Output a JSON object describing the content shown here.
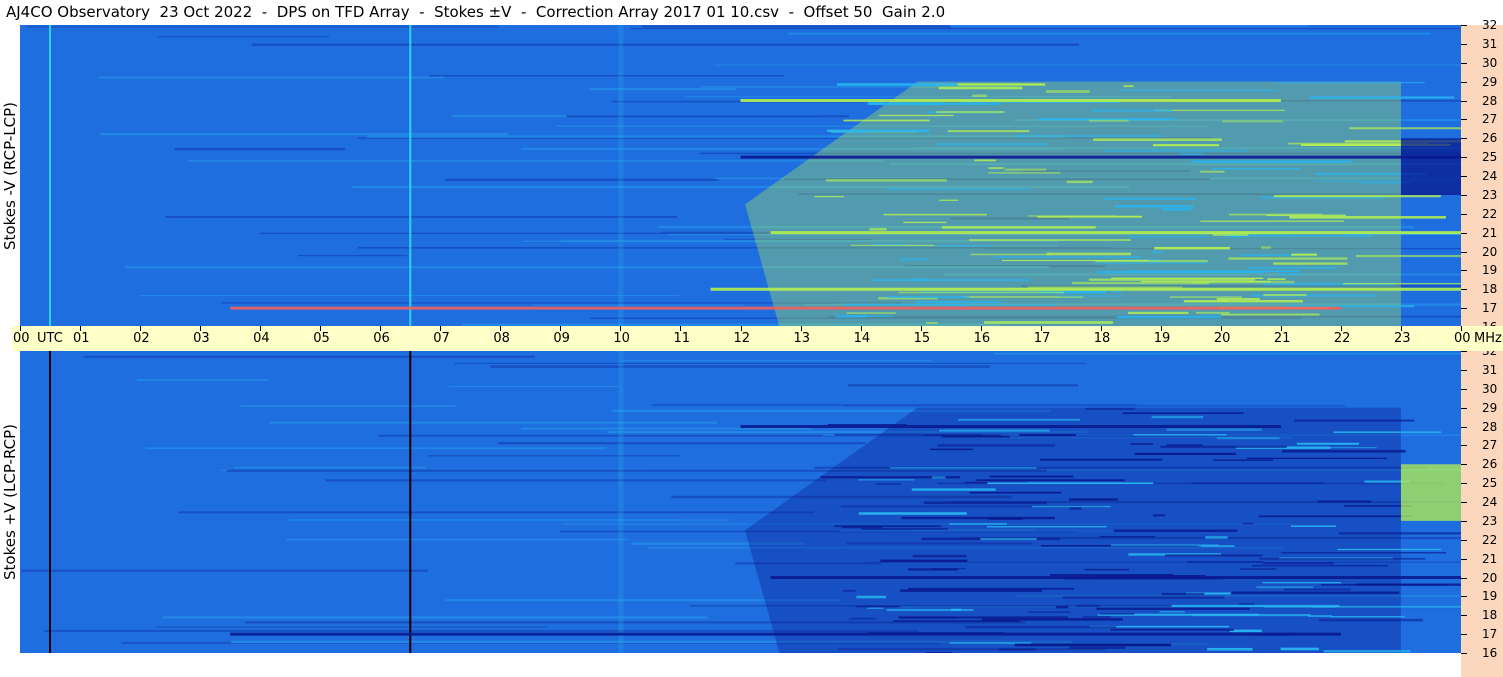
{
  "title": "AJ4CO Observatory  23 Oct 2022  -  DPS on TFD Array  -  Stokes ±V  -  Correction Array 2017 01 10.csv  -  Offset 50  Gain 2.0",
  "chart_data": [
    {
      "type": "heatmap",
      "panel": "top",
      "ylabel": "Stokes -V (RCP-LCP)",
      "x_axis": {
        "unit": "UTC",
        "range": [
          0,
          24
        ],
        "ticks": [
          "00",
          "01",
          "02",
          "03",
          "04",
          "05",
          "06",
          "07",
          "08",
          "09",
          "10",
          "11",
          "12",
          "13",
          "14",
          "15",
          "16",
          "17",
          "18",
          "19",
          "20",
          "21",
          "22",
          "23",
          "00"
        ]
      },
      "y_axis": {
        "unit": "MHz",
        "range": [
          16,
          32
        ],
        "ticks": [
          16,
          17,
          18,
          19,
          20,
          21,
          22,
          23,
          24,
          25,
          26,
          27,
          28,
          29,
          30,
          31,
          32
        ]
      },
      "colors": {
        "background": "#1e6ee0",
        "low": "#0a1a90",
        "mid": "#28b4f0",
        "high": "#b4f050",
        "peak": "#f06060"
      },
      "features": [
        {
          "kind": "vertical_line",
          "time_utc": 0.5,
          "color": "#2ad4e6"
        },
        {
          "kind": "vertical_line",
          "time_utc": 6.5,
          "color": "#2ad4e6"
        },
        {
          "kind": "active_region",
          "time_start_utc": 11.5,
          "time_end_utc": 23.0,
          "freq_start_mhz": 16.0,
          "freq_end_mhz": 29.0,
          "level": "high"
        },
        {
          "kind": "band",
          "freq_mhz": 28.0,
          "time_start_utc": 12.0,
          "time_end_utc": 21.0,
          "level": "high"
        },
        {
          "kind": "band",
          "freq_mhz": 21.0,
          "time_start_utc": 12.5,
          "time_end_utc": 24.0,
          "level": "high"
        },
        {
          "kind": "band",
          "freq_mhz": 18.0,
          "time_start_utc": 11.5,
          "time_end_utc": 24.0,
          "level": "high"
        },
        {
          "kind": "band",
          "freq_mhz": 17.0,
          "time_start_utc": 3.5,
          "time_end_utc": 22.0,
          "level": "peak"
        },
        {
          "kind": "band",
          "freq_mhz": 25.0,
          "time_start_utc": 12.0,
          "time_end_utc": 24.0,
          "level": "low"
        },
        {
          "kind": "block",
          "time_start_utc": 23.0,
          "time_end_utc": 24.0,
          "freq_start_mhz": 23.0,
          "freq_end_mhz": 26.0,
          "level": "low"
        }
      ]
    },
    {
      "type": "heatmap",
      "panel": "bottom",
      "ylabel": "Stokes +V (LCP-RCP)",
      "x_axis": {
        "unit": "UTC",
        "range": [
          0,
          24
        ]
      },
      "y_axis": {
        "unit": "MHz",
        "range": [
          16,
          32
        ],
        "ticks": [
          16,
          17,
          18,
          19,
          20,
          21,
          22,
          23,
          24,
          25,
          26,
          27,
          28,
          29,
          30,
          31,
          32
        ]
      },
      "colors": {
        "background": "#1e6ee0",
        "low": "#0a1a90",
        "mid": "#28b4f0",
        "high": "#b4f050"
      },
      "features": [
        {
          "kind": "vertical_line",
          "time_utc": 0.5,
          "color": "#000000"
        },
        {
          "kind": "vertical_line",
          "time_utc": 6.5,
          "color": "#000000"
        },
        {
          "kind": "active_region",
          "time_start_utc": 11.5,
          "time_end_utc": 23.0,
          "freq_start_mhz": 16.0,
          "freq_end_mhz": 29.0,
          "level": "low"
        },
        {
          "kind": "band",
          "freq_mhz": 28.0,
          "time_start_utc": 12.0,
          "time_end_utc": 21.0,
          "level": "low"
        },
        {
          "kind": "band",
          "freq_mhz": 20.0,
          "time_start_utc": 12.5,
          "time_end_utc": 24.0,
          "level": "low"
        },
        {
          "kind": "band",
          "freq_mhz": 17.0,
          "time_start_utc": 3.5,
          "time_end_utc": 22.0,
          "level": "low"
        },
        {
          "kind": "block",
          "time_start_utc": 23.0,
          "time_end_utc": 24.0,
          "freq_start_mhz": 23.0,
          "freq_end_mhz": 26.0,
          "level": "high"
        }
      ]
    }
  ],
  "axis_texts": {
    "utc": "UTC",
    "mhz": "MHz"
  }
}
